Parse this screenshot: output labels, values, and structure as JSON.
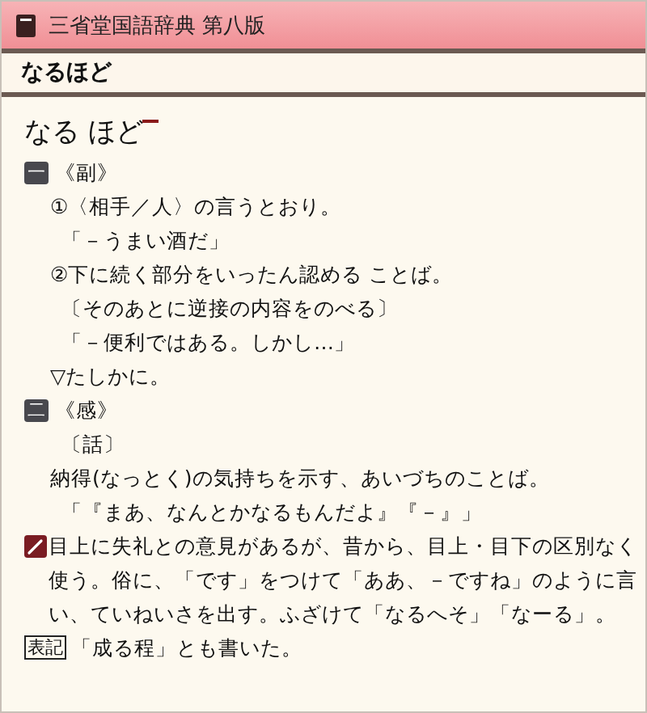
{
  "window": {
    "title": "三省堂国語辞典 第八版"
  },
  "header": {
    "word": "なるほど"
  },
  "entry": {
    "headword": "なる ほど",
    "accent": true,
    "lines": [
      {
        "kind": "pos",
        "badge": "一",
        "text": "《副》"
      },
      {
        "kind": "sense",
        "text": "①〈相手／人〉の言うとおり。"
      },
      {
        "kind": "example",
        "text": "「－うまい酒だ」"
      },
      {
        "kind": "sense",
        "text": "②下に続く部分をいったん認める ことば。"
      },
      {
        "kind": "example",
        "text": "〔そのあとに逆接の内容をのべる〕"
      },
      {
        "kind": "example",
        "text": "「－便利ではある。しかし…」"
      },
      {
        "kind": "sense",
        "text": "▽たしかに。"
      },
      {
        "kind": "pos",
        "badge": "二",
        "text": "《感》"
      },
      {
        "kind": "example",
        "text": "〔話〕"
      },
      {
        "kind": "sense",
        "text": "納得(なっとく)の気持ちを示す、あいづちのことば。"
      },
      {
        "kind": "example",
        "text": "「『まあ、なんとかなるもんだよ』『－』」"
      },
      {
        "kind": "note",
        "text": "目上に失礼との意見があるが、昔から、目上・目下の区別なく使う。俗に、「です」をつけて「ああ、－ですね」のように言い、ていねいさを出す。ふざけて「なるへそ」「なーる」。"
      },
      {
        "kind": "notation",
        "tag": "表記",
        "text": "「成る程」とも書いた。"
      }
    ]
  }
}
